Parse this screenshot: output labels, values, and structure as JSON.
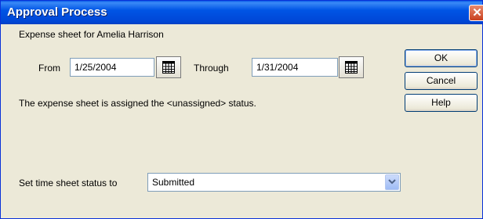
{
  "window": {
    "title": "Approval Process",
    "close_glyph": "✕"
  },
  "content": {
    "subject_label": "Expense sheet for Amelia Harrison",
    "from_label": "From",
    "from_value": "1/25/2004",
    "through_label": "Through",
    "through_value": "1/31/2004",
    "status_message": "The expense sheet is assigned the <unassigned> status.",
    "set_status_label": "Set time sheet status to",
    "status_selected": "Submitted"
  },
  "buttons": {
    "ok": "OK",
    "cancel": "Cancel",
    "help": "Help"
  },
  "icons": {
    "calendar": "calendar-icon",
    "dropdown": "chevron-down-icon",
    "close": "close-icon"
  },
  "colors": {
    "titlebar": "#0055e5",
    "face": "#ece9d8",
    "close": "#c8401f",
    "input_border": "#7f9db9"
  }
}
